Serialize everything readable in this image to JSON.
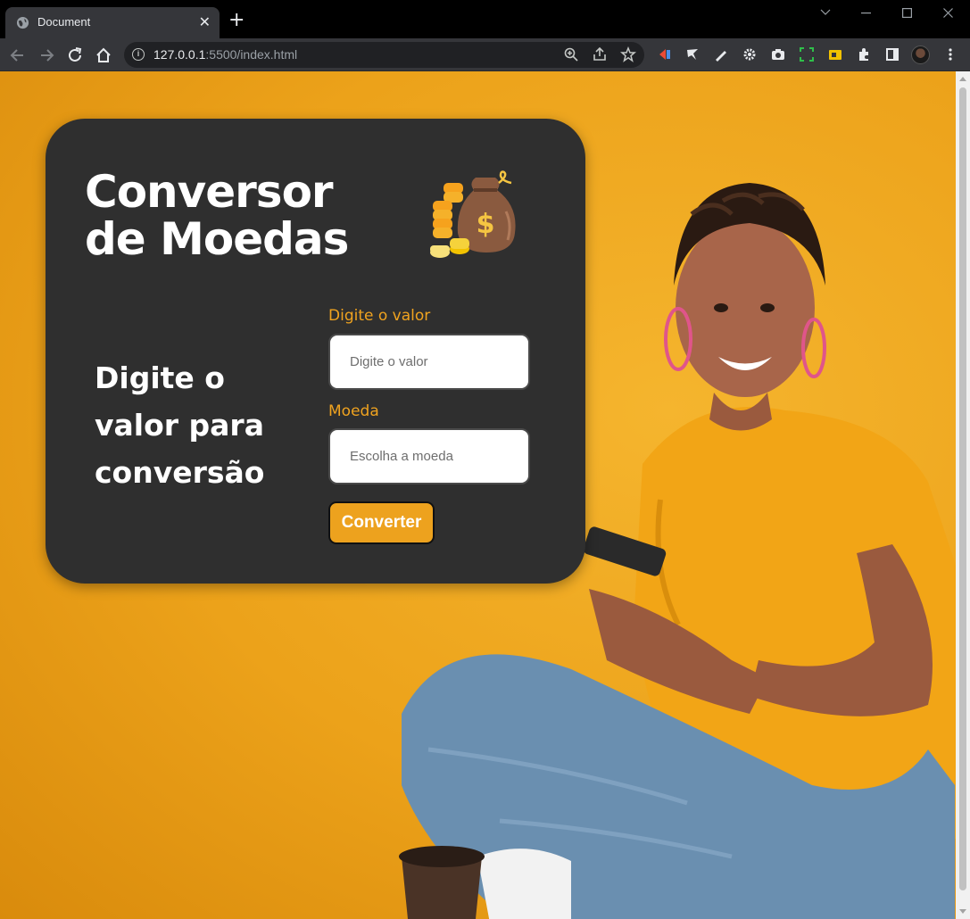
{
  "browser": {
    "tab_title": "Document",
    "close_glyph": "✕",
    "new_tab_glyph": "+",
    "url_host": "127.0.0.1",
    "url_rest": ":5500/index.html",
    "icons": [
      "back-icon",
      "forward-icon",
      "reload-icon",
      "home-icon",
      "info-icon",
      "zoom-icon",
      "share-icon",
      "bookmark-star-icon",
      "extensions-icon",
      "side-panel-icon",
      "menu-icon"
    ]
  },
  "card": {
    "title": "Conversor de Moedas",
    "side_text": "Digite o valor para conversão",
    "value_label": "Digite o valor",
    "value_placeholder": "Digite o valor",
    "currency_label": "Moeda",
    "currency_placeholder": "Escolha a moeda",
    "convert_label": "Converter"
  },
  "colors": {
    "background": "#eca21a",
    "card": "#2f2f2f",
    "accent": "#f0a31f",
    "button": "#eda21e"
  }
}
